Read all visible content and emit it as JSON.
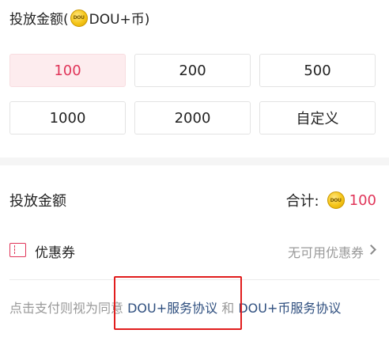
{
  "amount_section": {
    "title_prefix": "投放金额(",
    "coin_text": "DOU",
    "title_suffix": "DOU+币)",
    "options": [
      {
        "label": "100",
        "selected": true
      },
      {
        "label": "200",
        "selected": false
      },
      {
        "label": "500",
        "selected": false
      },
      {
        "label": "1000",
        "selected": false
      },
      {
        "label": "2000",
        "selected": false
      },
      {
        "label": "自定义",
        "selected": false
      }
    ]
  },
  "summary": {
    "row_label": "投放金额",
    "total_label": "合计:",
    "coin_text": "DOU",
    "total_value": "100"
  },
  "coupon": {
    "label": "优惠券",
    "value": "无可用优惠券"
  },
  "agreement": {
    "prefix": "点击支付则视为同意 ",
    "link1": "DOU+服务协议",
    "middle": " 和 ",
    "link2": "DOU+币服务协议"
  },
  "colors": {
    "accent": "#e03559",
    "selected_bg": "#fdecee",
    "link": "#2f4f7f",
    "highlight_box": "#e11d1d"
  }
}
